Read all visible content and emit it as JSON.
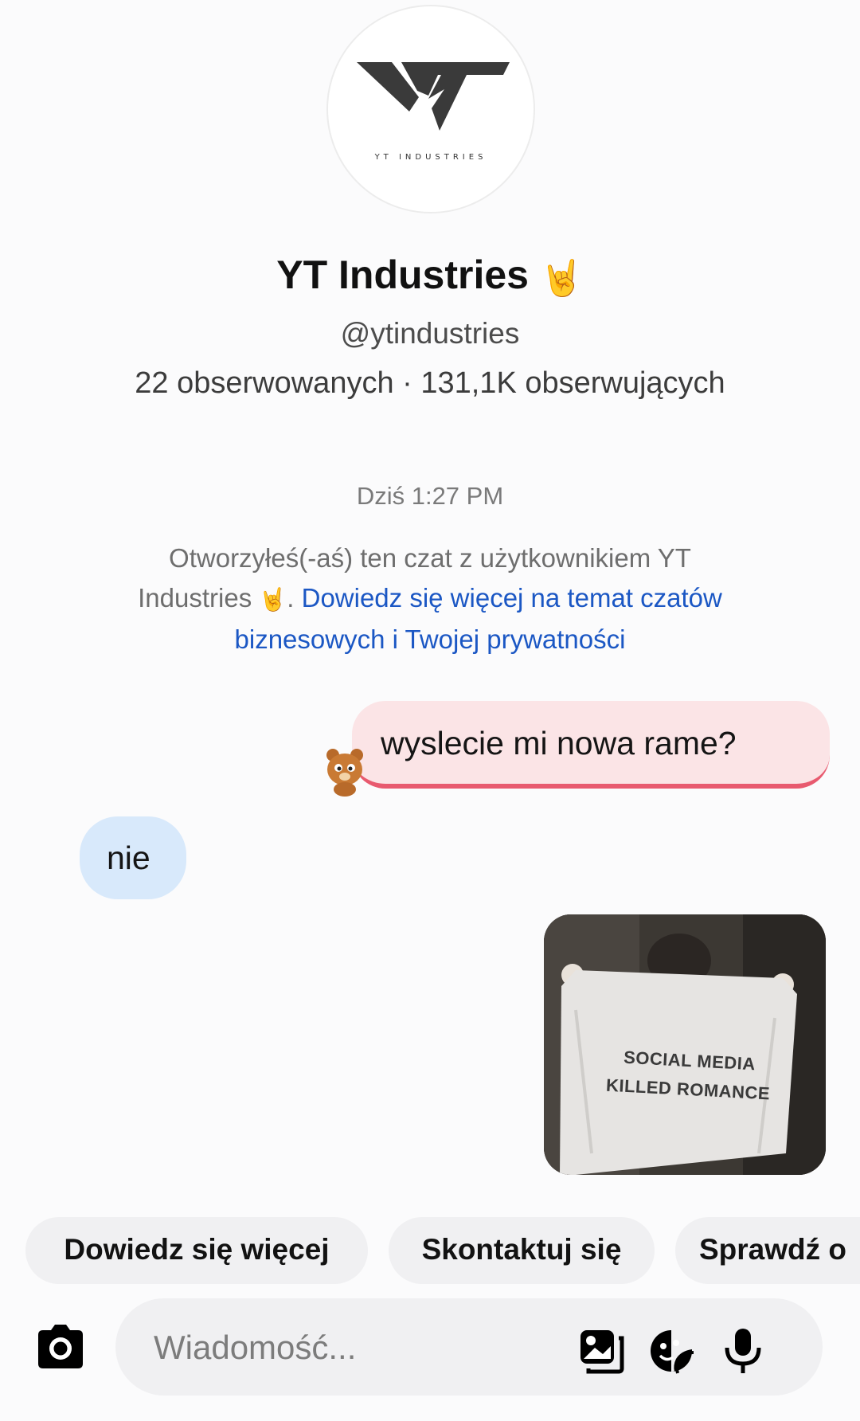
{
  "profile": {
    "logo_text": "YT",
    "logo_caption": "YT INDUSTRIES",
    "name": "YT Industries",
    "name_emoji": "🤘",
    "handle": "@ytindustries",
    "stats": "22 obserwowanych · 131,1K obserwujących"
  },
  "chat": {
    "timestamp": "Dziś 1:27 PM",
    "notice_text": "Otworzyłeś(-aś) ten czat z użytkownikiem YT Industries",
    "notice_emoji": "🤘",
    "notice_sep": ".",
    "notice_link": "Dowiedz się więcej na temat czatów biznesowych i Twojej prywatności",
    "messages": [
      {
        "from": "me",
        "text": "wyslecie mi nowa rame?"
      },
      {
        "from": "them",
        "text": "nie"
      },
      {
        "from": "me",
        "type": "image",
        "image_text": "SOCIAL MEDIA KILLED ROMANCE"
      }
    ]
  },
  "quick_replies": [
    "Dowiedz się więcej",
    "Skontaktuj się",
    "Sprawdź o"
  ],
  "composer": {
    "placeholder": "Wiadomość...",
    "icons": [
      "camera-icon",
      "gallery-icon",
      "sticker-icon",
      "microphone-icon"
    ]
  },
  "colors": {
    "out_bubble": "#fbe4e6",
    "out_accent": "#e85a6f",
    "in_bubble": "#d8e9fb",
    "link": "#1b57c4"
  }
}
